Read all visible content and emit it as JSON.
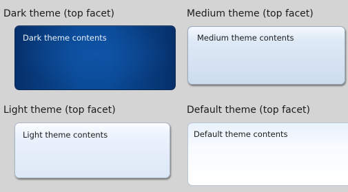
{
  "sections": {
    "dark": {
      "label": "Dark theme (top facet)",
      "contents": "Dark theme contents"
    },
    "medium": {
      "label": "Medium theme (top facet)",
      "contents": "Medium theme contents"
    },
    "light": {
      "label": "Light theme (top facet)",
      "contents": "Light theme contents"
    },
    "default": {
      "label": "Default theme (top facet)",
      "contents": "Default theme contents"
    }
  },
  "colors": {
    "background": "#d4d4d4",
    "dark_panel": "#0a4a96",
    "medium_panel": "#cddced",
    "light_panel": "#eaf2fc",
    "default_panel": "#ffffff"
  }
}
